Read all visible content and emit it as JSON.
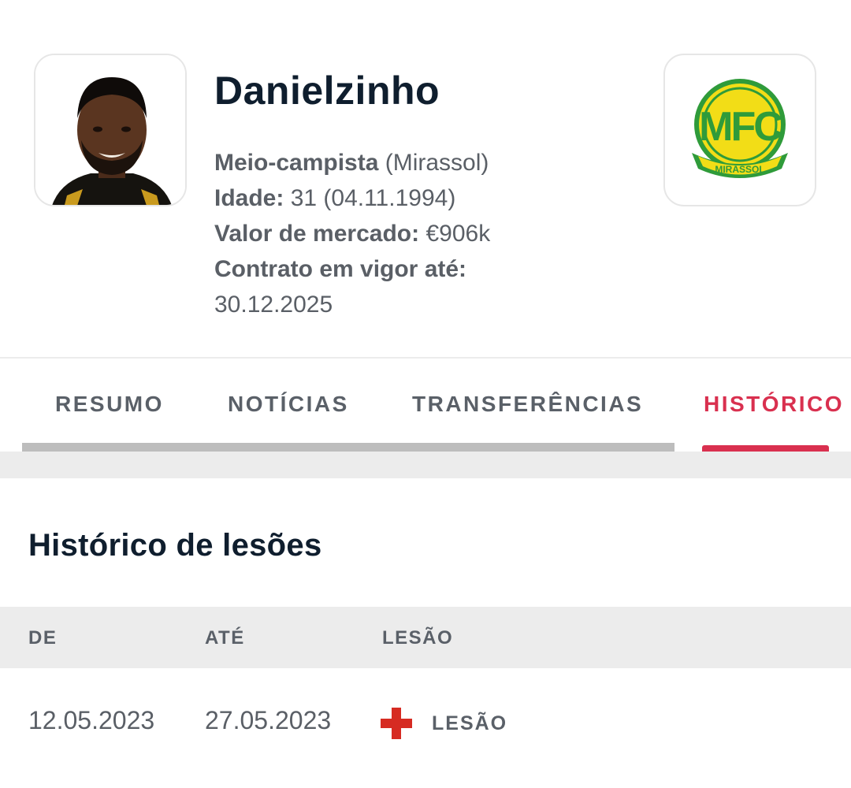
{
  "player": {
    "name": "Danielzinho",
    "position_label": "Meio-campista",
    "club": "(Mirassol)",
    "age_label": "Idade:",
    "age_value": "31 (04.11.1994)",
    "market_value_label": "Valor de mercado:",
    "market_value": "€906k",
    "contract_label": "Contrato em vigor até:",
    "contract_value": "30.12.2025"
  },
  "club_logo": {
    "monogram": "MFC",
    "banner": "MIRASSOL",
    "colors": {
      "green": "#2f9b3a",
      "yellow": "#f2dd17"
    }
  },
  "tabs": [
    {
      "label": "RESUMO"
    },
    {
      "label": "NOTÍCIAS"
    },
    {
      "label": "TRANSFERÊNCIAS"
    },
    {
      "label": "HISTÓRICO"
    }
  ],
  "active_tab_index": 3,
  "section": {
    "title": "Histórico de lesões"
  },
  "table": {
    "headers": [
      "DE",
      "ATÉ",
      "LESÃO"
    ],
    "rows": [
      {
        "from": "12.05.2023",
        "to": "27.05.2023",
        "injury_icon": "red-cross-icon",
        "injury": "LESÃO"
      }
    ]
  },
  "colors": {
    "accent": "#d9304f",
    "injury": "#d62b22",
    "band": "#ececec"
  }
}
